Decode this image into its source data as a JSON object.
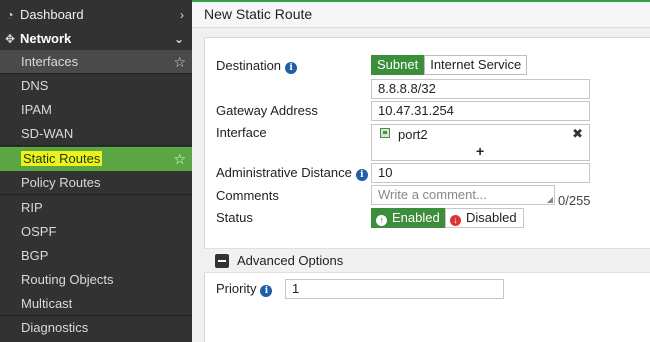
{
  "sidebar": {
    "items": [
      {
        "label": "Dashboard",
        "icon": "dashboard-icon",
        "chevron": "›"
      },
      {
        "label": "Network",
        "icon": "network-move-icon",
        "chevron": "⌄"
      },
      {
        "label": "Interfaces",
        "star": "☆"
      },
      {
        "label": "DNS"
      },
      {
        "label": "IPAM"
      },
      {
        "label": "SD-WAN"
      },
      {
        "label": "Static Routes",
        "star": "☆"
      },
      {
        "label": "Policy Routes"
      },
      {
        "label": "RIP"
      },
      {
        "label": "OSPF"
      },
      {
        "label": "BGP"
      },
      {
        "label": "Routing Objects"
      },
      {
        "label": "Multicast"
      },
      {
        "label": "Diagnostics"
      }
    ]
  },
  "header": {
    "title": "New Static Route"
  },
  "form": {
    "destination": {
      "label": "Destination",
      "options": [
        "Subnet",
        "Internet Service"
      ],
      "selected": "Subnet",
      "value": "8.8.8.8/32"
    },
    "gateway": {
      "label": "Gateway Address",
      "value": "10.47.31.254"
    },
    "interface": {
      "label": "Interface",
      "value": "port2",
      "remove": "✖",
      "add": "+"
    },
    "distance": {
      "label": "Administrative Distance",
      "value": "10"
    },
    "comments": {
      "label": "Comments",
      "placeholder": "Write a comment...",
      "counter": "0/255"
    },
    "status": {
      "label": "Status",
      "enabled": "Enabled",
      "disabled": "Disabled",
      "selected": "Enabled"
    }
  },
  "advanced": {
    "label": "Advanced Options",
    "priority": {
      "label": "Priority",
      "value": "1"
    }
  },
  "colors": {
    "accent": "#3c8d3c",
    "sidebar": "#323232",
    "highlight": "#eef21c",
    "active_item": "#5aa642"
  }
}
